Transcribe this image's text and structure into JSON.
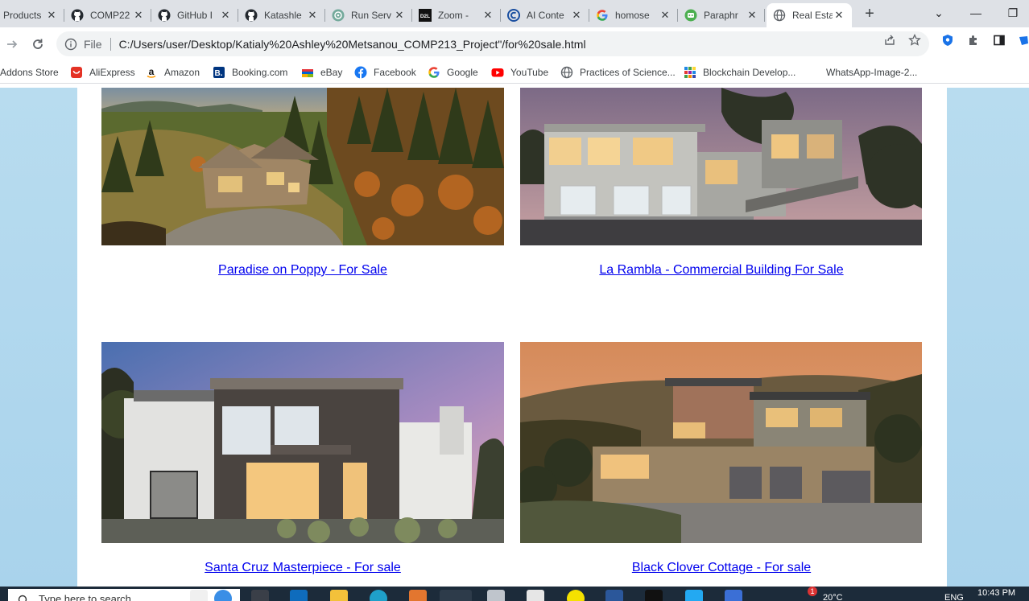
{
  "browser": {
    "tabs": [
      {
        "title": "Products",
        "icon": "generic-page-icon",
        "active": false
      },
      {
        "title": "COMP22",
        "icon": "github-icon",
        "active": false
      },
      {
        "title": "GitHub I",
        "icon": "github-icon",
        "active": false
      },
      {
        "title": "Katashle",
        "icon": "github-icon",
        "active": false
      },
      {
        "title": "Run Serv",
        "icon": "openai-icon",
        "active": false
      },
      {
        "title": "Zoom - ",
        "icon": "d2l-icon",
        "active": false
      },
      {
        "title": "AI Conte",
        "icon": "c-logo-icon",
        "active": false
      },
      {
        "title": "homose",
        "icon": "google-icon",
        "active": false
      },
      {
        "title": "Paraphr",
        "icon": "robot-icon",
        "active": false
      },
      {
        "title": "Real Esta",
        "icon": "globe-icon",
        "active": true
      }
    ],
    "close_glyph": "✕",
    "new_tab_glyph": "+",
    "window_controls": {
      "dropdown": "⌄",
      "minimize": "—",
      "restore": "❐"
    },
    "address": {
      "scheme_label": "File",
      "url": "C:/Users/user/Desktop/Katialy%20Ashley%20Metsanou_COMP213_Project\"/for%20sale.html"
    },
    "bookmarks": [
      {
        "label": "Addons Store",
        "icon": ""
      },
      {
        "label": "AliExpress",
        "icon": "aliexpress-icon"
      },
      {
        "label": "Amazon",
        "icon": "amazon-icon"
      },
      {
        "label": "Booking.com",
        "icon": "booking-icon"
      },
      {
        "label": "eBay",
        "icon": "ebay-icon"
      },
      {
        "label": "Facebook",
        "icon": "facebook-icon"
      },
      {
        "label": "Google",
        "icon": "google-icon"
      },
      {
        "label": "YouTube",
        "icon": "youtube-icon"
      },
      {
        "label": "Practices of Science...",
        "icon": "globe-icon"
      },
      {
        "label": "Blockchain Develop...",
        "icon": "grid-icon"
      },
      {
        "label": "WhatsApp-Image-2...",
        "icon": ""
      }
    ]
  },
  "page": {
    "listings": [
      {
        "title": "Paradise on Poppy - For Sale",
        "photo": "coastal-estate-photo"
      },
      {
        "title": "La Rambla - Commercial Building For Sale",
        "photo": "modern-garage-house-photo"
      },
      {
        "title": "Santa Cruz Masterpiece - For sale",
        "photo": "modern-cube-house-photo"
      },
      {
        "title": "Black Clover Cottage - For sale",
        "photo": "hillside-stone-house-photo"
      }
    ]
  },
  "taskbar": {
    "search_placeholder": "Type here to search",
    "weather": "20°C",
    "language": "ENG",
    "time": "10:43 PM",
    "notification_count": "1"
  },
  "colors": {
    "link": "#0000ee",
    "page_background": "#a9d3ec",
    "tabstrip": "#dee1e6"
  }
}
